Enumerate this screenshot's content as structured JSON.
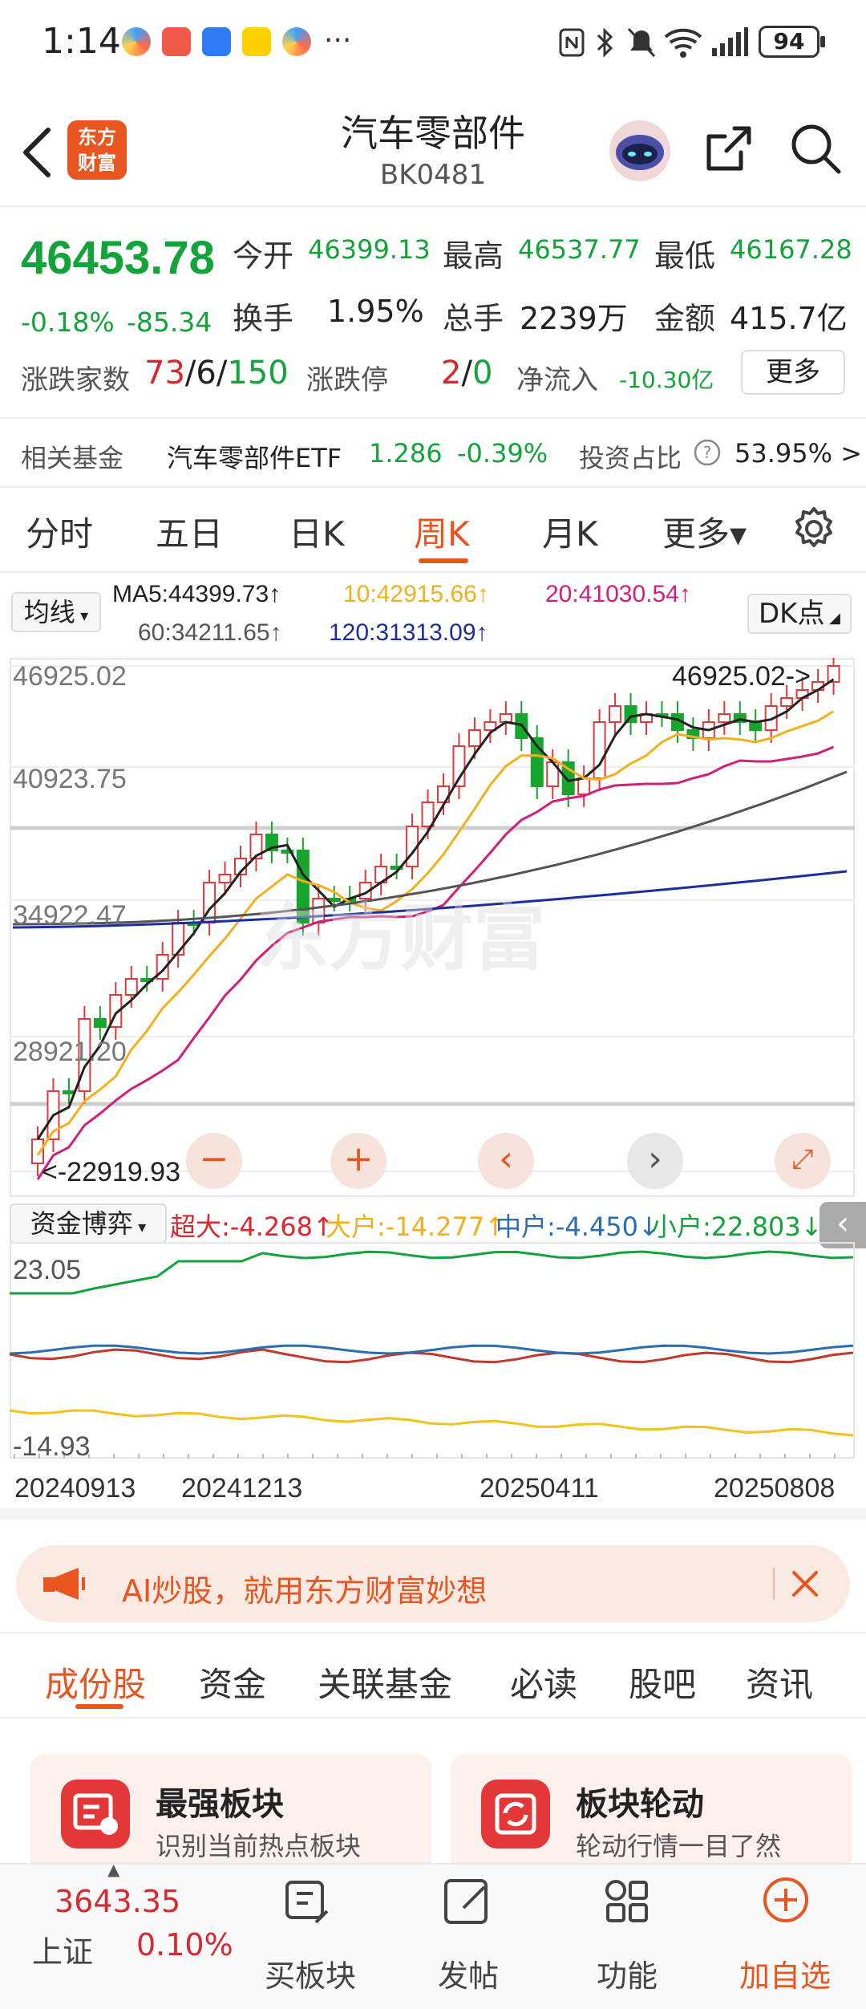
{
  "status_bar": {
    "time": "1:14",
    "more": "···",
    "battery": "94"
  },
  "header": {
    "logo_text_1": "东方",
    "logo_text_2": "财富",
    "title": "汽车零部件",
    "code": "BK0481"
  },
  "quote": {
    "price": "46453.78",
    "change_pct": "-0.18%",
    "change": "-85.34",
    "open_label": "今开",
    "open": "46399.13",
    "high_label": "最高",
    "high": "46537.77",
    "low_label": "最低",
    "low": "46167.28",
    "turnover_label": "换手",
    "turnover": "1.95%",
    "volume_label": "总手",
    "volume": "2239万",
    "amount_label": "金额",
    "amount": "415.7亿",
    "breadth_label": "涨跌家数",
    "breadth_up": "73",
    "breadth_sep1": "/",
    "breadth_flat": "6",
    "breadth_sep2": "/",
    "breadth_down": "150",
    "limit_label": "涨跌停",
    "limit_up": "2",
    "limit_sep": "/",
    "limit_down": "0",
    "netflow_label": "净流入",
    "netflow": "-10.30亿",
    "more_button": "更多"
  },
  "fund": {
    "label": "相关基金",
    "name": "汽车零部件ETF",
    "price": "1.286",
    "change": "-0.39%",
    "ratio_label": "投资占比",
    "ratio": "53.95% >"
  },
  "tabs": [
    "分时",
    "五日",
    "日K",
    "周K",
    "月K",
    "更多▾"
  ],
  "indicator": {
    "selector": "均线",
    "ma5": "MA5:44399.73↑",
    "ma10": "10:42915.66↑",
    "ma20": "20:41030.54↑",
    "ma60": "60:34211.65↑",
    "ma120": "120:31313.09↑",
    "dk_button": "DK点"
  },
  "chart": {
    "y_labels": [
      "46925.02",
      "40923.75",
      "34922.47",
      "28921.20"
    ],
    "high_marker": "46925.02->",
    "low_marker": "<-22919.93",
    "watermark": "东方财富",
    "colors": {
      "up": "#e03a3a",
      "down": "#18a52e",
      "ma5": "#222222",
      "ma10": "#f2b01e",
      "ma20": "#d0207a",
      "ma60": "#555555",
      "ma120": "#1c2e9c"
    }
  },
  "chart_data": {
    "type": "candlestick",
    "title": "汽车零部件 周K",
    "ylim": [
      22919.93,
      46925.02
    ],
    "x_dates": [
      "20240913",
      "20241213",
      "20250411",
      "20250808"
    ],
    "notes_high": 46925.02,
    "notes_low": 22919.93
  },
  "flow": {
    "selector": "资金博弈",
    "super": "超大:-4.268↑",
    "large": "大户:-14.277↑",
    "medium": "中户:-4.450↓",
    "small": "小户:22.803↓",
    "y_top": "23.05",
    "y_bottom": "-14.93"
  },
  "dates": [
    "20240913",
    "20241213",
    "20250411",
    "20250808"
  ],
  "banner": {
    "text": "AI炒股，就用东方财富妙想"
  },
  "sub_tabs": [
    "成份股",
    "资金",
    "关联基金",
    "必读",
    "股吧",
    "资讯"
  ],
  "cards": [
    {
      "title": "最强板块",
      "subtitle": "识别当前热点板块"
    },
    {
      "title": "板块轮动",
      "subtitle": "轮动行情一目了然"
    }
  ],
  "bottom_bar": {
    "index_value": "3643.35",
    "index_name": "上证",
    "index_change": "0.10%",
    "items": [
      "买板块",
      "发帖",
      "功能",
      "加自选"
    ]
  }
}
